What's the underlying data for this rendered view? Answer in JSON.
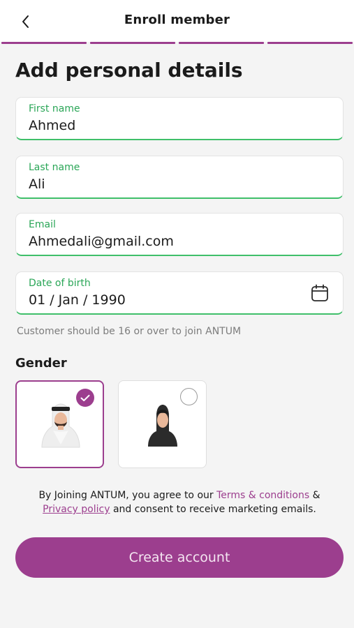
{
  "header": {
    "title": "Enroll member",
    "back_icon": "chevron-left-icon"
  },
  "progress": {
    "steps_total": 4,
    "steps_completed": 4
  },
  "page_title": "Add personal details",
  "fields": [
    {
      "label": "First name",
      "value": "Ahmed"
    },
    {
      "label": "Last name",
      "value": "Ali"
    },
    {
      "label": "Email",
      "value": "Ahmedali@gmail.com"
    },
    {
      "label": "Date of birth",
      "value": "01 / Jan / 1990",
      "icon": "calendar-icon"
    }
  ],
  "hint": "Customer should be 16 or over to join ANTUM",
  "gender": {
    "title": "Gender",
    "options": [
      {
        "id": "male",
        "selected": true
      },
      {
        "id": "female",
        "selected": false
      }
    ]
  },
  "terms": {
    "prefix": "By Joining ANTUM, you agree to our ",
    "terms_link": "Terms & conditions",
    "and": " & ",
    "privacy_link": "Privacy policy",
    "suffix": " and consent to receive marketing emails."
  },
  "cta_label": "Create account",
  "colors": {
    "brand": "#9c3e8e",
    "field_label": "#2aa657",
    "field_underline": "#3fbf6a",
    "background": "#f4f4f4"
  }
}
